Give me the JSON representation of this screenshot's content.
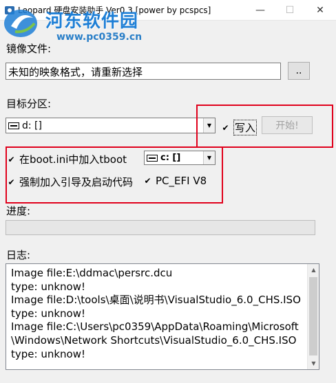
{
  "window": {
    "title": "Leopard 硬盘安装助手 Ver0.3 [power by pcspcs]",
    "minimize_glyph": "—",
    "maximize_glyph": "☐",
    "close_glyph": "✕"
  },
  "watermark": {
    "title": "河东软件园",
    "url": "www.pc0359.cn"
  },
  "image_file": {
    "label": "镜像文件:",
    "value": "未知的映象格式，请重新选择",
    "browse_label": ".."
  },
  "target": {
    "label": "目标分区:",
    "selected": "d: []",
    "write_label": "写入",
    "start_label": "开始!"
  },
  "options": {
    "boot_ini_label": "在boot.ini中加入tboot",
    "boot_drive_selected": "c: []",
    "force_boot_label": "强制加入引导及启动代码",
    "pc_efi_label": "PC_EFI V8"
  },
  "progress": {
    "label": "进度:",
    "value": 0
  },
  "log": {
    "label": "日志:",
    "lines": [
      "Image file:E:\\ddmac\\persrc.dcu",
      "type: unknow!",
      "Image file:D:\\tools\\桌面\\说明书\\VisualStudio_6.0_CHS.ISO",
      "type: unknow!",
      "Image file:C:\\Users\\pc0359\\AppData\\Roaming\\Microsoft",
      "\\Windows\\Network Shortcuts\\VisualStudio_6.0_CHS.ISO",
      "type: unknow!"
    ]
  },
  "colors": {
    "highlight_frame": "#e0001b",
    "watermark_blue": "#1e7fd6"
  }
}
